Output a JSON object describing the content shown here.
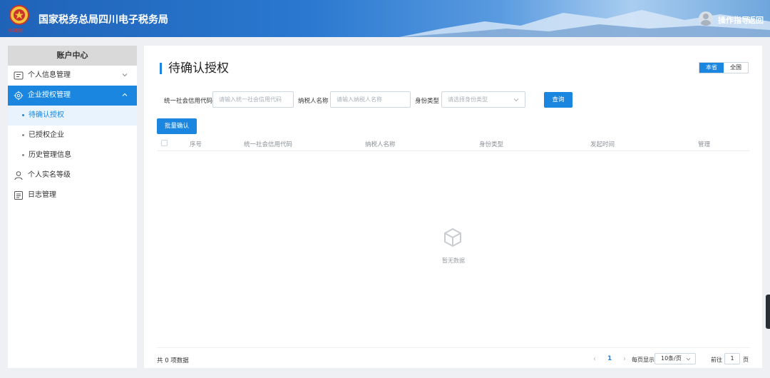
{
  "header": {
    "title": "国家税务总局四川电子税务局",
    "emblem_script": "中国税务",
    "guide_label": "操作指导",
    "back_label": "返回"
  },
  "sidebar": {
    "heading": "账户中心",
    "items": [
      {
        "label": "个人信息管理",
        "icon": "id-card-icon"
      },
      {
        "label": "企业授权管理",
        "icon": "gear-icon"
      },
      {
        "label": "个人实名等级",
        "icon": "user-icon"
      },
      {
        "label": "日志管理",
        "icon": "log-icon"
      }
    ],
    "sub_items": [
      {
        "label": "待确认授权"
      },
      {
        "label": "已授权企业"
      },
      {
        "label": "历史管理信息"
      }
    ]
  },
  "main": {
    "title": "待确认授权",
    "scope": {
      "local": "本省",
      "all": "全国"
    },
    "filters": {
      "credit_code_label": "统一社会信用代码",
      "credit_code_placeholder": "请输入统一社会信用代码",
      "taxpayer_label": "纳税人名称",
      "taxpayer_placeholder": "请输入纳税人名称",
      "identity_label": "身份类型",
      "identity_placeholder": "请选择身份类型",
      "query_button": "查询"
    },
    "batch_button": "批量确认",
    "table": {
      "columns": [
        "序号",
        "统一社会信用代码",
        "纳税人名称",
        "身份类型",
        "发起时间",
        "管理"
      ],
      "rows": []
    },
    "empty_text": "暂无数据",
    "pagination": {
      "total": "共 0 项数据",
      "current_page": "1",
      "per_page_label": "每页显示",
      "per_page_value": "10条/页",
      "goto_label": "前往",
      "goto_value": "1",
      "page_suffix": "页"
    }
  },
  "colors": {
    "accent": "#1a86e0",
    "sidebar_active_bg": "#1a86e0",
    "sub_active_bg": "#e8f3fe"
  }
}
